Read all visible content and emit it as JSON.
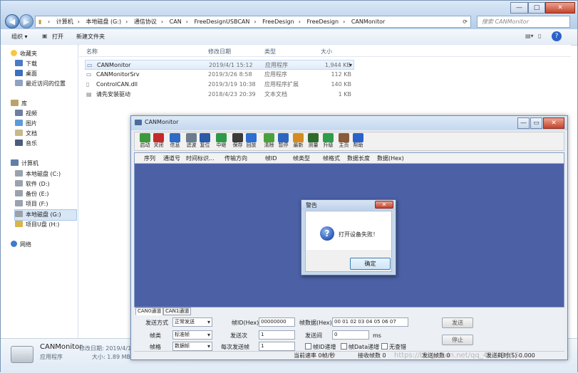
{
  "explorer": {
    "breadcrumb": [
      "计算机",
      "本地磁盘 (G:)",
      "通信协议",
      "CAN",
      "FreeDesignUSBCAN",
      "FreeDesign",
      "FreeDesign",
      "CANMonitor"
    ],
    "search_placeholder": "搜索 CANMonitor",
    "toolbar": {
      "organize": "组织 ▾",
      "open": "打开",
      "new_folder": "新建文件夹"
    },
    "nav": {
      "favorites_title": "收藏夹",
      "favorites": [
        "下载",
        "桌面",
        "最近访问的位置"
      ],
      "libraries_title": "库",
      "libraries": [
        "视频",
        "图片",
        "文档",
        "音乐"
      ],
      "computer_title": "计算机",
      "drives": [
        "本地磁盘 (C:)",
        "软件 (D:)",
        "备份 (E:)",
        "项目 (F:)",
        "本地磁盘 (G:)",
        "项目U盘 (H:)"
      ],
      "network_title": "网络"
    },
    "columns": {
      "name": "名称",
      "date": "修改日期",
      "type": "类型",
      "size": "大小"
    },
    "files": [
      {
        "name": "CANMonitor",
        "date": "2019/4/1 15:12",
        "type": "应用程序",
        "size": "1,944 KB"
      },
      {
        "name": "CANMonitorSrv",
        "date": "2019/3/26 8:58",
        "type": "应用程序",
        "size": "112 KB"
      },
      {
        "name": "ControlCAN.dll",
        "date": "2019/3/19 10:38",
        "type": "应用程序扩展",
        "size": "140 KB"
      },
      {
        "name": "请先安装驱动",
        "date": "2018/4/23 20:39",
        "type": "文本文档",
        "size": "1 KB"
      }
    ],
    "details": {
      "name": "CANMonitor",
      "modified_label": "修改日期: 2019/4/1",
      "type": "应用程序",
      "size_label": "大小: 1.89 MB"
    }
  },
  "canmonitor": {
    "title": "CANMonitor",
    "tools": [
      {
        "label": "启动",
        "icon": "start-icon",
        "color": "#3c9a3c"
      },
      {
        "label": "关闭",
        "icon": "close-device-icon",
        "color": "#c42a2a"
      },
      {
        "label": "信息",
        "icon": "info-icon",
        "color": "#2e6bc7"
      },
      {
        "label": "滤波",
        "icon": "filter-icon",
        "color": "#6a7d8e"
      },
      {
        "label": "复位",
        "icon": "reset-icon",
        "color": "#2a5aa8"
      },
      {
        "label": "中继",
        "icon": "relay-icon",
        "color": "#2d9a4a"
      },
      {
        "label": "保存",
        "icon": "save-icon",
        "color": "#3a3a3a"
      },
      {
        "label": "回放",
        "icon": "playback-icon",
        "color": "#2a6fd1"
      },
      {
        "label": "清除",
        "icon": "clear-icon",
        "color": "#4aa13c"
      },
      {
        "label": "暂停",
        "icon": "pause-icon",
        "color": "#2d66c0"
      },
      {
        "label": "最新",
        "icon": "latest-icon",
        "color": "#d48c22"
      },
      {
        "label": "测量",
        "icon": "measure-icon",
        "color": "#2d6b2d"
      },
      {
        "label": "升级",
        "icon": "upgrade-icon",
        "color": "#2f9c4a"
      },
      {
        "label": "主页",
        "icon": "home-icon",
        "color": "#8a5a3a"
      },
      {
        "label": "帮助",
        "icon": "help-icon",
        "color": "#2a62c9"
      }
    ],
    "grid_columns": [
      "序列",
      "通道号",
      "时间标识...",
      "传输方向",
      "帧ID",
      "帧类型",
      "帧格式",
      "数据长度",
      "数据(Hex)"
    ],
    "tabs": [
      "CAN0通道",
      "CAN1通道"
    ],
    "form": {
      "send_mode_label": "发送方式",
      "send_mode": "正常发送",
      "frame_id_label": "帧ID(Hex):",
      "frame_id": "00000000",
      "frame_data_label": "帧数据(Hex):",
      "frame_data": "00 01 02 03 04 05 06 07",
      "frame_kind_label": "帧类",
      "frame_kind": "标准帧",
      "send_count_label": "发送次",
      "send_count": "1",
      "send_interval_label": "发送间",
      "send_interval": "0",
      "interval_unit": "ms",
      "frame_format_label": "帧格",
      "frame_format": "数据帧",
      "frames_per_send_label": "每次发送帧",
      "frames_per_send": "1",
      "id_inc_label": "帧ID递增",
      "data_inc_label": "帧Data递增",
      "no_verify_label": "无查错",
      "send_button": "发送",
      "stop_button": "停止"
    },
    "status": {
      "rate": "当前速率 0帧/秒",
      "recv_count": "接收帧数 0",
      "sent_count": "发送帧数 0",
      "sent_time": "发送耗时(S) 0.000"
    }
  },
  "alert": {
    "title": "警告",
    "message": "打开设备失败！",
    "ok_button": "确定"
  },
  "watermark": "https://blog.csdn.net/qq_43445975"
}
